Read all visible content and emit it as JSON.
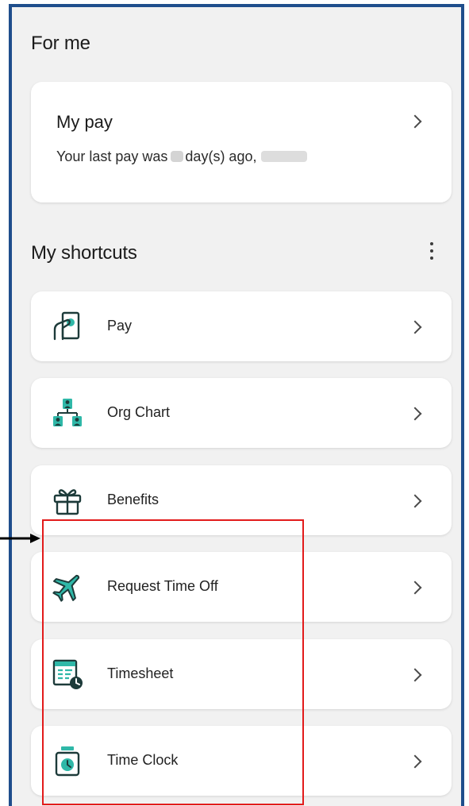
{
  "sections": {
    "for_me": "For me",
    "my_shortcuts": "My shortcuts"
  },
  "pay_card": {
    "title": "My pay",
    "subtitle_prefix": "Your last pay was",
    "subtitle_middle": "day(s) ago,"
  },
  "shortcuts": [
    {
      "label": "Pay",
      "icon": "pay-hand-icon"
    },
    {
      "label": "Org Chart",
      "icon": "org-chart-icon"
    },
    {
      "label": "Benefits",
      "icon": "gift-icon"
    },
    {
      "label": "Request Time Off",
      "icon": "airplane-icon"
    },
    {
      "label": "Timesheet",
      "icon": "timesheet-clock-icon"
    },
    {
      "label": "Time Clock",
      "icon": "time-clock-icon"
    }
  ],
  "colors": {
    "frame_border": "#1f4e8c",
    "background": "#f1f1f1",
    "icon_teal": "#2fb8a8",
    "icon_dark": "#1d3b3a",
    "highlight": "#e21b1b"
  }
}
